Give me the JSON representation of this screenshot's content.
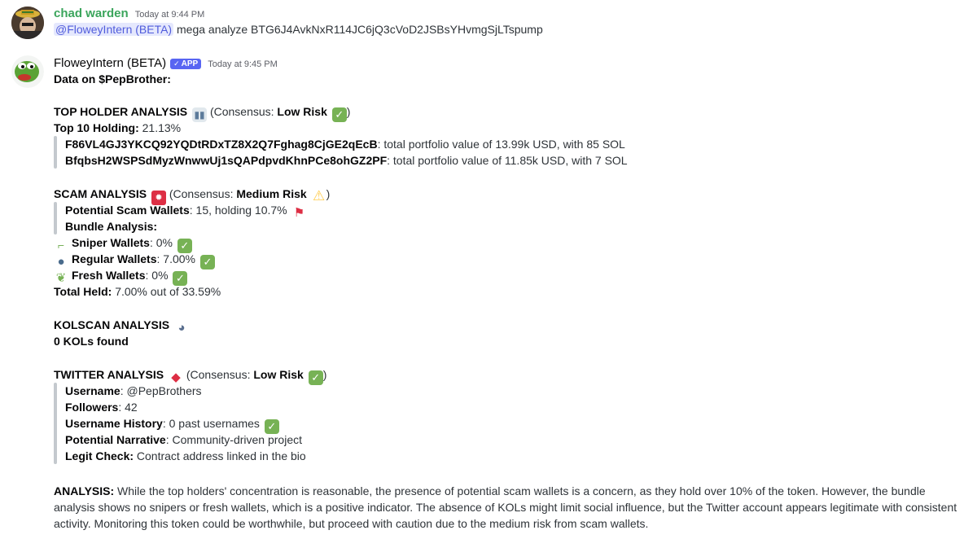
{
  "messages": [
    {
      "author": "chad warden",
      "author_color": "#3ba55c",
      "timestamp": "Today at 9:44 PM",
      "mention": "@FloweyIntern (BETA)",
      "text": "mega analyze BTG6J4AvkNxR114JC6jQ3cVoD2JSBsYHvmgSjLTspump"
    },
    {
      "author": "FloweyIntern (BETA)",
      "author_color": "#060607",
      "tag": "APP",
      "timestamp": "Today at 9:45 PM",
      "heading": "Data on $PepBrother:",
      "top_holder": {
        "title": "TOP HOLDER ANALYSIS",
        "consensus_prefix": "(Consensus: ",
        "consensus": "Low Risk",
        "close": ")",
        "top10_label": "Top 10 Holding:",
        "top10_value": "21.13%",
        "holders": [
          {
            "address": "F86VL4GJ3YKCQ92YQDtRDxTZ8X2Q7Fghag8CjGE2qEcB",
            "desc": ": total portfolio value of 13.99k USD, with 85 SOL"
          },
          {
            "address": "BfqbsH2WSPSdMyzWnwwUj1sQAPdpvdKhnPCe8ohGZ2PF",
            "desc": ": total portfolio value of 11.85k USD, with 7 SOL"
          }
        ]
      },
      "scam": {
        "title": "SCAM ANALYSIS",
        "consensus_prefix": "(Consensus: ",
        "consensus": "Medium Risk",
        "close": ")",
        "potential_label": "Potential Scam Wallets",
        "potential_value": ": 15, holding 10.7%",
        "bundle_label": "Bundle Analysis:",
        "sniper_label": "Sniper Wallets",
        "sniper_value": ": 0%",
        "regular_label": "Regular Wallets",
        "regular_value": ": 7.00%",
        "fresh_label": "Fresh Wallets",
        "fresh_value": ": 0%",
        "total_label": "Total Held:",
        "total_value": "7.00% out of 33.59%"
      },
      "kolscan": {
        "title": "KOLSCAN ANALYSIS",
        "result": "0 KOLs found"
      },
      "twitter": {
        "title": "TWITTER ANALYSIS",
        "consensus_prefix": "(Consensus: ",
        "consensus": "Low Risk",
        "close": ")",
        "username_label": "Username",
        "username_value": ": @PepBrothers",
        "followers_label": "Followers",
        "followers_value": ": 42",
        "history_label": "Username History",
        "history_value": ": 0 past usernames",
        "narrative_label": "Potential Narrative",
        "narrative_value": ": Community-driven project",
        "legit_label": "Legit Check:",
        "legit_value": " Contract address linked in the bio"
      },
      "analysis_label": "ANALYSIS:",
      "analysis_text": " While the top holders' concentration is reasonable, the presence of potential scam wallets is a concern, as they hold over 10% of the token. However, the bundle analysis shows no snipers or fresh wallets, which is a positive indicator. The absence of KOLs might limit social influence, but the Twitter account appears legitimate with consistent activity. Monitoring this token could be worthwhile, but proceed with caution due to the medium risk from scam wallets."
    }
  ],
  "icons": {
    "check": "✓",
    "chart": "▮▮",
    "siren": "✹",
    "warning": "⚠",
    "flag": "⚑",
    "gun": "⌐",
    "user": "●",
    "sprout": "❦",
    "speaking_head": "◕",
    "bird": "◆"
  }
}
